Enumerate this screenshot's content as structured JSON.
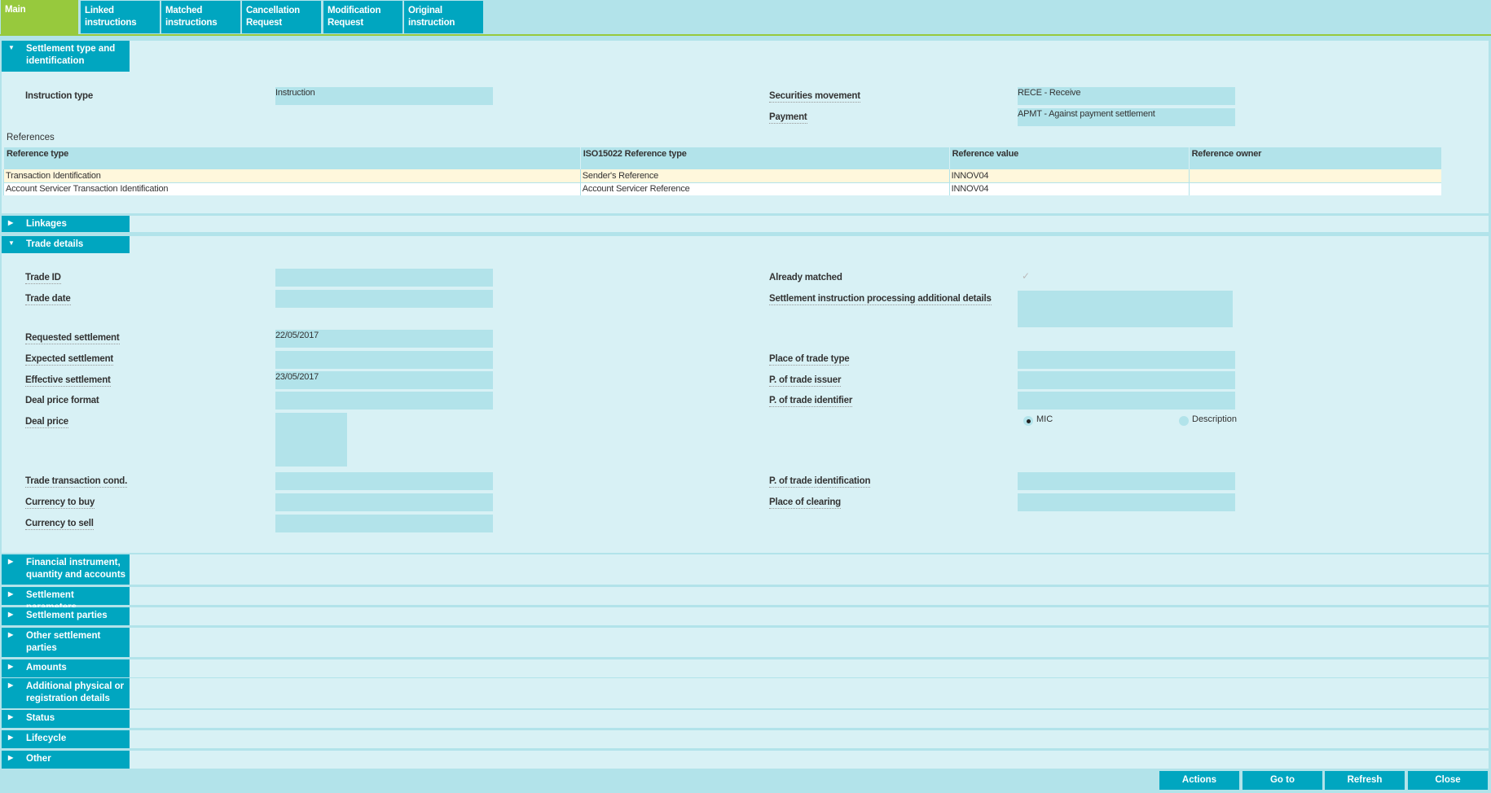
{
  "tabs": [
    {
      "label": "Main",
      "active": true
    },
    {
      "label": "Linked instructions"
    },
    {
      "label": "Matched instructions"
    },
    {
      "label": "Cancellation Request"
    },
    {
      "label": "Modification Request"
    },
    {
      "label": "Original instruction"
    }
  ],
  "sections": {
    "settlement_type": {
      "title": "Settlement type and identification",
      "expanded": true,
      "instruction_type_label": "Instruction type",
      "instruction_type_value": "Instruction",
      "securities_movement_label": "Securities movement",
      "securities_movement_value": "RECE - Receive",
      "payment_label": "Payment",
      "payment_value": "APMT - Against payment settlement",
      "references_title": "References",
      "references": {
        "columns": [
          "Reference type",
          "ISO15022 Reference type",
          "Reference value",
          "Reference owner"
        ],
        "rows": [
          [
            "Transaction Identification",
            "Sender's Reference",
            "INNOV04",
            ""
          ],
          [
            "Account Servicer Transaction Identification",
            "Account Servicer Reference",
            "INNOV04",
            ""
          ]
        ]
      }
    },
    "linkages": {
      "title": "Linkages",
      "expanded": false
    },
    "trade_details": {
      "title": "Trade details",
      "expanded": true,
      "left": [
        {
          "label": "Trade ID",
          "value": ""
        },
        {
          "label": "Trade date",
          "value": ""
        },
        {
          "label": "Requested settlement",
          "value": "22/05/2017"
        },
        {
          "label": "Expected settlement",
          "value": ""
        },
        {
          "label": "Effective settlement",
          "value": "23/05/2017"
        },
        {
          "label": "Deal price format",
          "value": ""
        },
        {
          "label": "Deal price",
          "value": ""
        },
        {
          "label": "Trade transaction cond.",
          "value": ""
        },
        {
          "label": "Currency to buy",
          "value": ""
        },
        {
          "label": "Currency to sell",
          "value": ""
        }
      ],
      "right": [
        {
          "label": "Already matched",
          "checked": true
        },
        {
          "label": "Settlement instruction processing additional details",
          "value": ""
        },
        {
          "label": "Place of trade type",
          "value": ""
        },
        {
          "label": "P. of trade issuer",
          "value": ""
        },
        {
          "label": "P. of trade identifier",
          "value": ""
        },
        {
          "label": "P. of trade identification",
          "value": ""
        },
        {
          "label": "Place of clearing",
          "value": ""
        }
      ],
      "radio_options": [
        {
          "label": "MIC",
          "selected": true
        },
        {
          "label": "Description",
          "selected": false
        }
      ]
    },
    "collapsed": [
      "Financial instrument, quantity and accounts",
      "Settlement parameters",
      "Settlement parties",
      "Other settlement parties",
      "Amounts",
      "Additional physical or registration details",
      "Status",
      "Lifecycle",
      "Other"
    ]
  },
  "icons": {
    "expanded": "▼",
    "collapsed": "▶",
    "check": "✓"
  },
  "buttons": {
    "actions": "Actions",
    "goto": "Go to",
    "refresh": "Refresh",
    "close": "Close"
  },
  "colors": {
    "accent": "#00a6c0",
    "active_tab": "#97c93d",
    "panel_bg": "#d8f1f5",
    "field_bg": "#b2e3ea",
    "highlight_row": "#fff7dc"
  }
}
